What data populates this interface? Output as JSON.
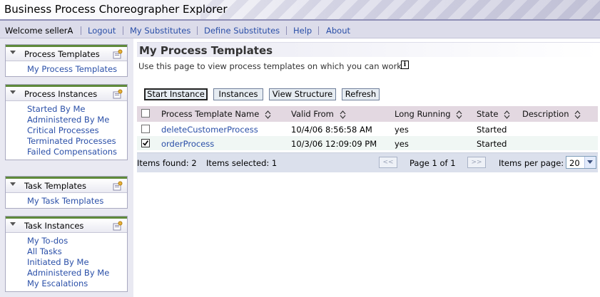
{
  "app": {
    "title": "Business Process Choreographer Explorer"
  },
  "nav": {
    "welcome": "Welcome sellerA",
    "links": [
      "Logout",
      "My Substitutes",
      "Define Substitutes",
      "Help",
      "About"
    ]
  },
  "sidebar": {
    "panels": [
      {
        "title": "Process Templates",
        "items": [
          "My Process Templates"
        ]
      },
      {
        "title": "Process Instances",
        "items": [
          "Started By Me",
          "Administered By Me",
          "Critical Processes",
          "Terminated Processes",
          "Failed Compensations"
        ]
      },
      {
        "title": "Task Templates",
        "items": [
          "My Task Templates"
        ]
      },
      {
        "title": "Task Instances",
        "items": [
          "My To-dos",
          "All Tasks",
          "Initiated By Me",
          "Administered By Me",
          "My Escalations"
        ]
      }
    ]
  },
  "main": {
    "title": "My Process Templates",
    "description": "Use this page to view process templates on which you can work",
    "info_icon": "i",
    "toolbar": [
      "Start Instance",
      "Instances",
      "View Structure",
      "Refresh"
    ],
    "table": {
      "columns": [
        "Process Template Name",
        "Valid From",
        "Long Running",
        "State",
        "Description"
      ],
      "rows": [
        {
          "name": "deleteCustomerProcess",
          "valid_from": "10/4/06 8:56:58 AM",
          "long_running": "yes",
          "state": "Started",
          "description": "",
          "selected": false
        },
        {
          "name": "orderProcess",
          "valid_from": "10/3/06 12:09:09 PM",
          "long_running": "yes",
          "state": "Started",
          "description": "",
          "selected": true
        }
      ]
    },
    "footer": {
      "items_found_label": "Items found:",
      "items_found": "2",
      "items_selected_label": "Items selected:",
      "items_selected": "1",
      "prev": "<<",
      "page": "Page 1 of 1",
      "next": ">>",
      "per_page_label": "Items per page:",
      "per_page": "20"
    }
  },
  "colors": {
    "link": "#2a4fa8",
    "panel_accent": "#5f8a3b",
    "header_row": "#e3d8e1",
    "nav_bg": "#dcdcea"
  }
}
